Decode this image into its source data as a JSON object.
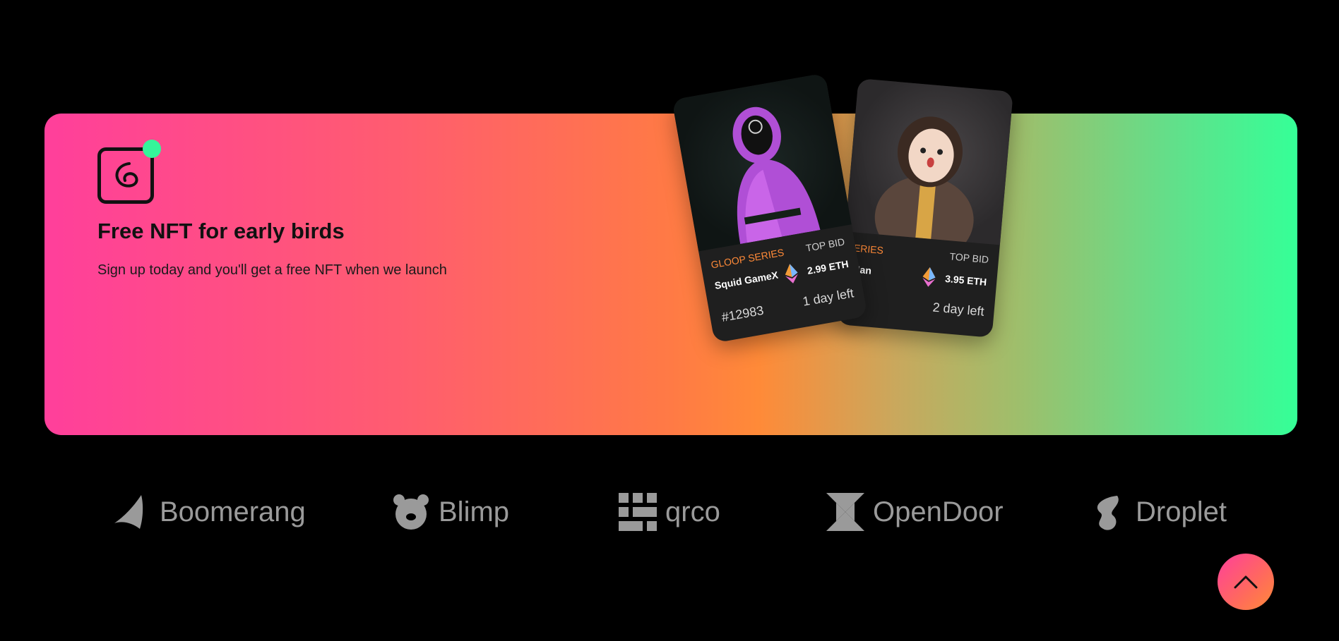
{
  "banner": {
    "title": "Free NFT for early birds",
    "subtitle": "Sign up today and you'll get a free NFT when we launch",
    "logo_icon": "spiral-logo-icon",
    "notification_dot_color": "#35f59a"
  },
  "cards": [
    {
      "series": "GLOOP SERIES",
      "top_bid_label": "TOP BID",
      "name": "Squid GameX",
      "price": "2.99 ETH",
      "id": "#12983",
      "time_left": "1 day left",
      "art": "pink-hooded-figure-art"
    },
    {
      "series": "P SERIES",
      "top_bid_label": "TOP BID",
      "name": "Man",
      "price": "3.95 ETH",
      "id": "",
      "time_left": "2 day left",
      "art": "doll-character-art"
    }
  ],
  "partners": [
    {
      "name": "Boomerang",
      "icon": "boomerang-icon"
    },
    {
      "name": "Blimp",
      "icon": "bear-icon"
    },
    {
      "name": "qrco",
      "icon": "qr-icon"
    },
    {
      "name": "OpenDoor",
      "icon": "open-door-icon"
    },
    {
      "name": "Droplet",
      "icon": "droplet-icon"
    }
  ],
  "scroll_top": {
    "icon": "chevron-up-icon"
  },
  "colors": {
    "accent_orange": "#ff8a38",
    "gradient_start": "#ff3f9b",
    "gradient_end": "#35ff97"
  }
}
